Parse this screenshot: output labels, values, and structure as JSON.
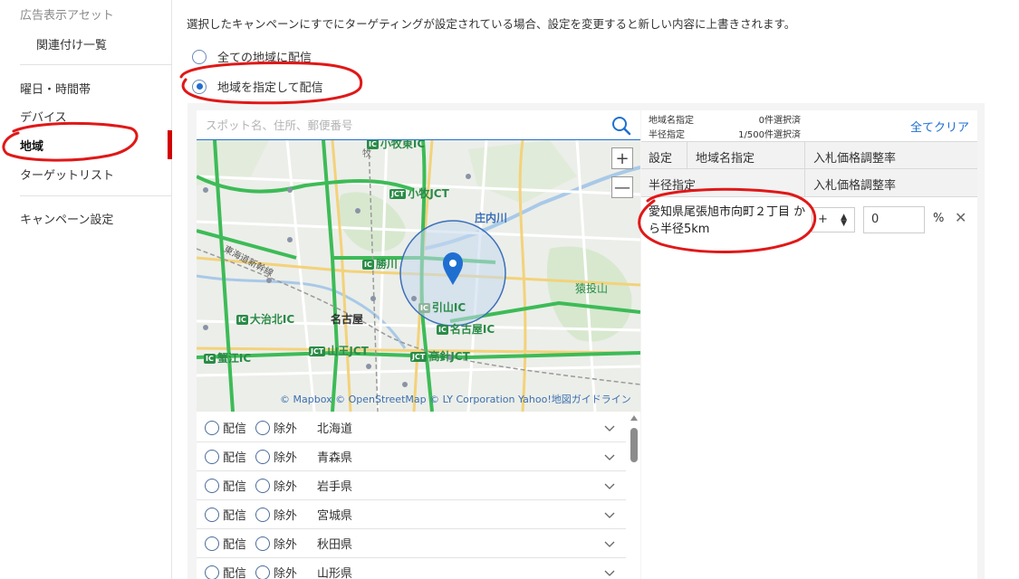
{
  "sidebar": {
    "items": [
      {
        "label": "広告表示アセット"
      },
      {
        "label": "関連付け一覧"
      },
      {
        "label": "曜日・時間帯"
      },
      {
        "label": "デバイス"
      },
      {
        "label": "地域"
      },
      {
        "label": "ターゲットリスト"
      },
      {
        "label": "キャンペーン設定"
      }
    ],
    "active": "地域"
  },
  "notice": "選択したキャンペーンにすでにターゲティングが設定されている場合、設定を変更すると新しい内容に上書きされます。",
  "radios": [
    {
      "label": "全ての地域に配信",
      "checked": false
    },
    {
      "label": "地域を指定して配信",
      "checked": true
    }
  ],
  "search": {
    "placeholder": "スポット名、住所、郵便番号"
  },
  "map": {
    "labels": {
      "komaki_ic": "小牧東IC",
      "komaki_jct": "小牧JCT",
      "shonai": "庄内川",
      "katsukawa": "勝川",
      "sanageyama": "猿投山",
      "tokaido": "東海道新幹線",
      "hikiyama_ic": "引山IC",
      "ozone": "大治北IC",
      "nagoya": "名古屋",
      "nagoya_ic": "名古屋IC",
      "sanno_jct": "山王JCT",
      "takabari_jct": "高針JCT",
      "kanie_ic": "蟹江IC",
      "maki": "牧",
      "badge_ic": "IC",
      "badge_jct": "JCT"
    },
    "zoom_in": "+",
    "zoom_out": "—",
    "attribution": "© Mapbox © OpenStreetMap © LY Corporation Yahoo!地図ガイドライン"
  },
  "prefectures": {
    "deliver_label": "配信",
    "exclude_label": "除外",
    "items": [
      "北海道",
      "青森県",
      "岩手県",
      "宮城県",
      "秋田県",
      "山形県"
    ]
  },
  "summary": {
    "region_label": "地域名指定",
    "region_value": "0件選択済",
    "radius_label": "半径指定",
    "radius_value": "1/500件選択済",
    "clear_all": "全てクリア"
  },
  "table": {
    "header1": {
      "setting": "設定",
      "region": "地域名指定",
      "bid": "入札価格調整率"
    },
    "header2": {
      "radius": "半径指定",
      "bid": "入札価格調整率"
    },
    "rows": [
      {
        "location": "愛知県尾張旭市向町２丁目 から半径5km",
        "sign": "+",
        "value": "0",
        "unit": "%"
      }
    ]
  },
  "colors": {
    "accent": "#1f6fd1",
    "active_bar": "#d30000",
    "annotation": "#e01818"
  }
}
